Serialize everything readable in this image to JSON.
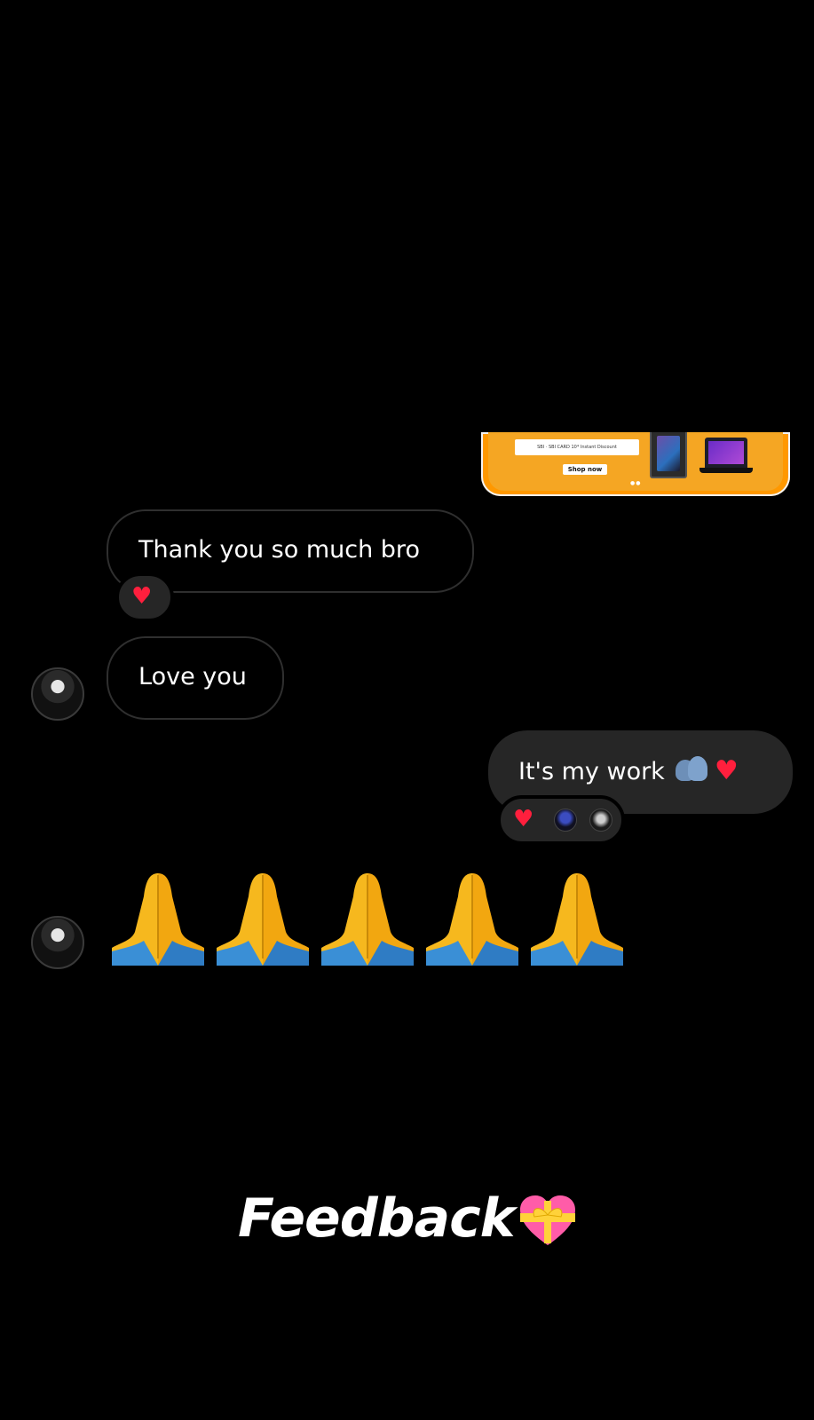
{
  "shared_card": {
    "promo_text": "SBI · SBI CARD  10* Instant Discount",
    "shop_button": "Shop now",
    "dots": "●●"
  },
  "messages": [
    {
      "direction": "incoming",
      "text": "Thank you so much bro",
      "reactions": [
        "heart"
      ]
    },
    {
      "direction": "incoming",
      "text": "Love you"
    },
    {
      "direction": "outgoing",
      "text": "It's my work",
      "inline_emojis": [
        "people-hugging-icon",
        "heart-icon"
      ],
      "reactions": [
        "heart"
      ]
    },
    {
      "direction": "incoming",
      "emoji_only": "🙏🙏🙏🙏🙏",
      "count": 5
    }
  ],
  "footer": {
    "label": "Feedback",
    "icon": "heart-with-ribbon-icon"
  },
  "colors": {
    "background": "#000000",
    "outgoing_bubble": "#262626",
    "incoming_border": "#2f2f2f",
    "heart": "#ff1f3d",
    "card_orange": "#ff9800"
  }
}
